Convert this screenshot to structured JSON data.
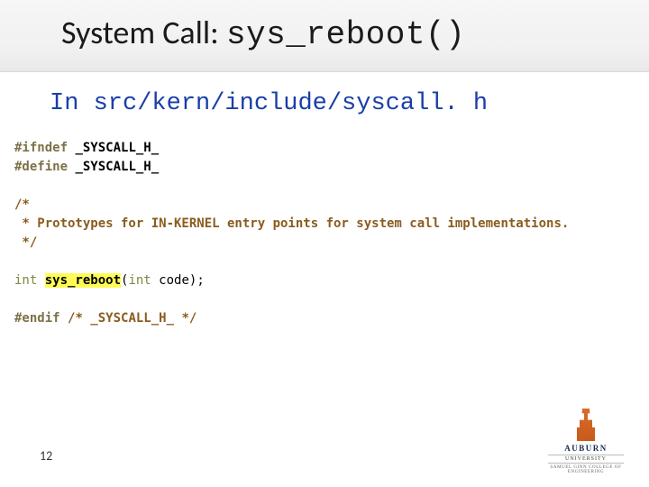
{
  "title": {
    "prefix": "System Call: ",
    "code": "sys_reboot()"
  },
  "path": {
    "prefix": "In ",
    "value": "src/kern/include/syscall. h"
  },
  "code": {
    "l1_pp": "#ifndef ",
    "l1_macro": "_SYSCALL_H_",
    "l2_pp": "#define ",
    "l2_macro": "_SYSCALL_H_",
    "l3": "/*",
    "l4": " * Prototypes for IN-KERNEL entry points for system call implementations.",
    "l5": " */",
    "l6_type": "int ",
    "l6_fn": "sys_reboot",
    "l6_paren_open": "(",
    "l6_param_type": "int ",
    "l6_param_name": "code",
    "l6_paren_close": ")",
    "l6_semi": ";",
    "l7_pp": "#endif ",
    "l7_cmt": "/* _SYSCALL_H_ */"
  },
  "page_number": "12",
  "logo": {
    "name": "AUBURN",
    "sub1": "UNIVERSITY",
    "sub2": "SAMUEL GINN COLLEGE OF ENGINEERING"
  }
}
